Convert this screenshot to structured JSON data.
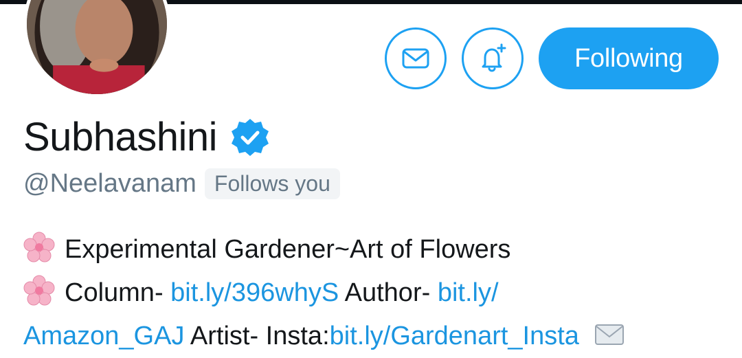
{
  "profile": {
    "name": "Subhashini",
    "handle": "@Neelavanam",
    "follows_you": "Follows you"
  },
  "actions": {
    "following_label": "Following"
  },
  "bio": {
    "line1": "Experimental Gardener~Art of Flowers",
    "line2_a": "Column- ",
    "line2_link1": "bit.ly/396whyS",
    "line2_b": " Author- ",
    "line2_link2": "bit.ly/",
    "line3_link1": "Amazon_GAJ",
    "line3_b": " Artist- Insta:",
    "line3_link2": "bit.ly/Gardenart_Insta"
  },
  "colors": {
    "accent": "#1da1f2",
    "link": "#1b95e0",
    "secondary_text": "#657786",
    "primary_text": "#14171a"
  },
  "icons": {
    "message": "envelope-icon",
    "notifications": "bell-plus-icon",
    "verified": "verified-badge-icon",
    "bio_emoji": "cherry-blossom-icon",
    "envelope_emoji": "envelope-emoji-icon"
  }
}
